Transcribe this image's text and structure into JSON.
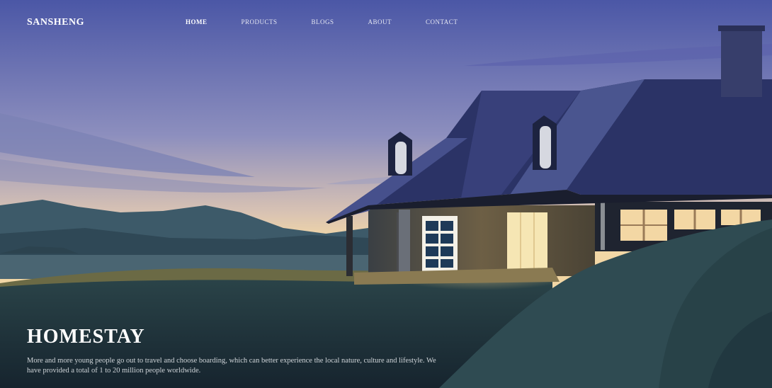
{
  "brand": {
    "name": "SANSHENG"
  },
  "nav": {
    "items": [
      {
        "label": "HOME",
        "active": true
      },
      {
        "label": "PRODUCTS",
        "active": false
      },
      {
        "label": "BLOGS",
        "active": false
      },
      {
        "label": "ABOUT",
        "active": false
      },
      {
        "label": "CONTACT",
        "active": false
      }
    ]
  },
  "hero": {
    "title": "HOMESTAY",
    "description": "More and more young people go out to travel and choose boarding, which can better experience the local nature, culture and lifestyle. We have provided a total of 1 to 20 million people worldwide."
  },
  "colors": {
    "sky_top": "#4c5aa8",
    "sky_horizon": "#f0d6a8",
    "roof": "#2a3266",
    "window_light": "#f6e6b4",
    "hill": "#2e4c52"
  }
}
